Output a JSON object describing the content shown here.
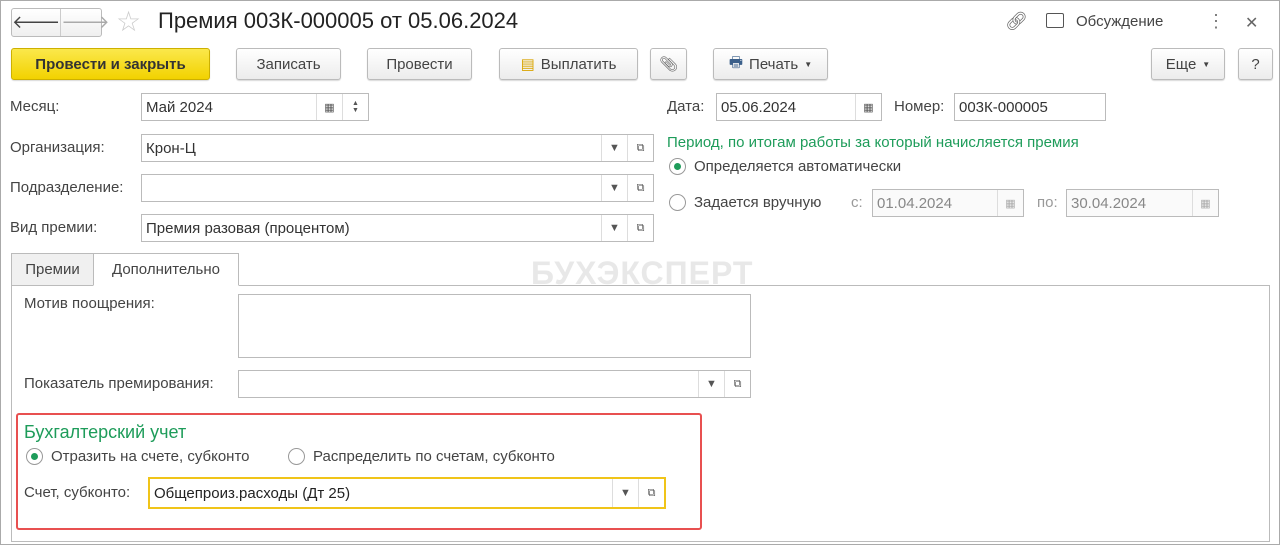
{
  "header": {
    "title": "Премия 003К-000005 от 05.06.2024",
    "discussion": "Обсуждение"
  },
  "toolbar": {
    "post_close": "Провести и закрыть",
    "save": "Записать",
    "post": "Провести",
    "pay": "Выплатить",
    "print": "Печать",
    "more": "Еще",
    "help": "?"
  },
  "form": {
    "month_label": "Месяц:",
    "month_value": "Май 2024",
    "org_label": "Организация:",
    "org_value": "Крон-Ц",
    "dept_label": "Подразделение:",
    "dept_value": "",
    "type_label": "Вид премии:",
    "type_value": "Премия разовая (процентом)",
    "date_label": "Дата:",
    "date_value": "05.06.2024",
    "number_label": "Номер:",
    "number_value": "003К-000005",
    "period_title": "Период, по итогам работы за который начисляется премия",
    "period_auto": "Определяется автоматически",
    "period_manual": "Задается вручную",
    "from_label": "с:",
    "from_value": "01.04.2024",
    "to_label": "по:",
    "to_value": "30.04.2024"
  },
  "tabs": [
    {
      "label": "Премии"
    },
    {
      "label": "Дополнительно"
    }
  ],
  "additional": {
    "motive_label": "Мотив поощрения:",
    "motive_value": "",
    "indicator_label": "Показатель премирования:",
    "indicator_value": "",
    "accounting_title": "Бухгалтерский учет",
    "option_single": "Отразить на счете, субконто",
    "option_distribute": "Распределить по счетам, субконто",
    "account_label": "Счет, субконто:",
    "account_value": "Общепроиз.расходы (Дт 25)"
  },
  "watermark": "БУХЭКСПЕРТ"
}
